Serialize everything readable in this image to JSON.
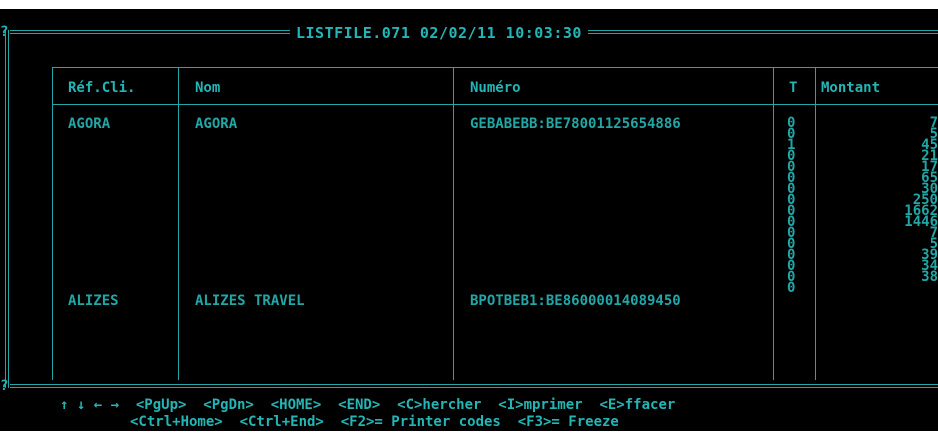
{
  "window": {
    "title": "LISTFILE.071 02/02/11 10:03:30",
    "top_marker": "?",
    "bottom_marker": "?"
  },
  "table": {
    "headers": {
      "ref": "Réf.Cli.",
      "nom": "Nom",
      "numero": "Numéro",
      "t": "T",
      "montant": "Montant"
    },
    "rows": [
      {
        "ref": "AGORA",
        "nom": "AGORA",
        "numero": "GEBABEBB:BE78001125654886"
      },
      {
        "ref": "ALIZES",
        "nom": "ALIZES TRAVEL",
        "numero": "BPOTBEB1:BE86000014089450"
      }
    ],
    "t_values": [
      "0",
      "0",
      "1",
      "0",
      "0",
      "0",
      "0",
      "0",
      "0",
      "0",
      "0",
      "0",
      "0",
      "0",
      "0",
      "0"
    ],
    "montant_values": [
      "7",
      "5",
      "45",
      "21",
      "17",
      "65",
      "30",
      "250",
      "1662",
      "1446",
      "7",
      "5",
      "39",
      "34",
      "38"
    ]
  },
  "footer": {
    "line1": "↑ ↓ ← →  <PgUp>  <PgDn>  <HOME>  <END>  <C>hercher  <I>mprimer  <E>ffacer",
    "line2": "<Ctrl+Home>  <Ctrl+End>  <F2>= Printer codes  <F3>= Freeze"
  }
}
